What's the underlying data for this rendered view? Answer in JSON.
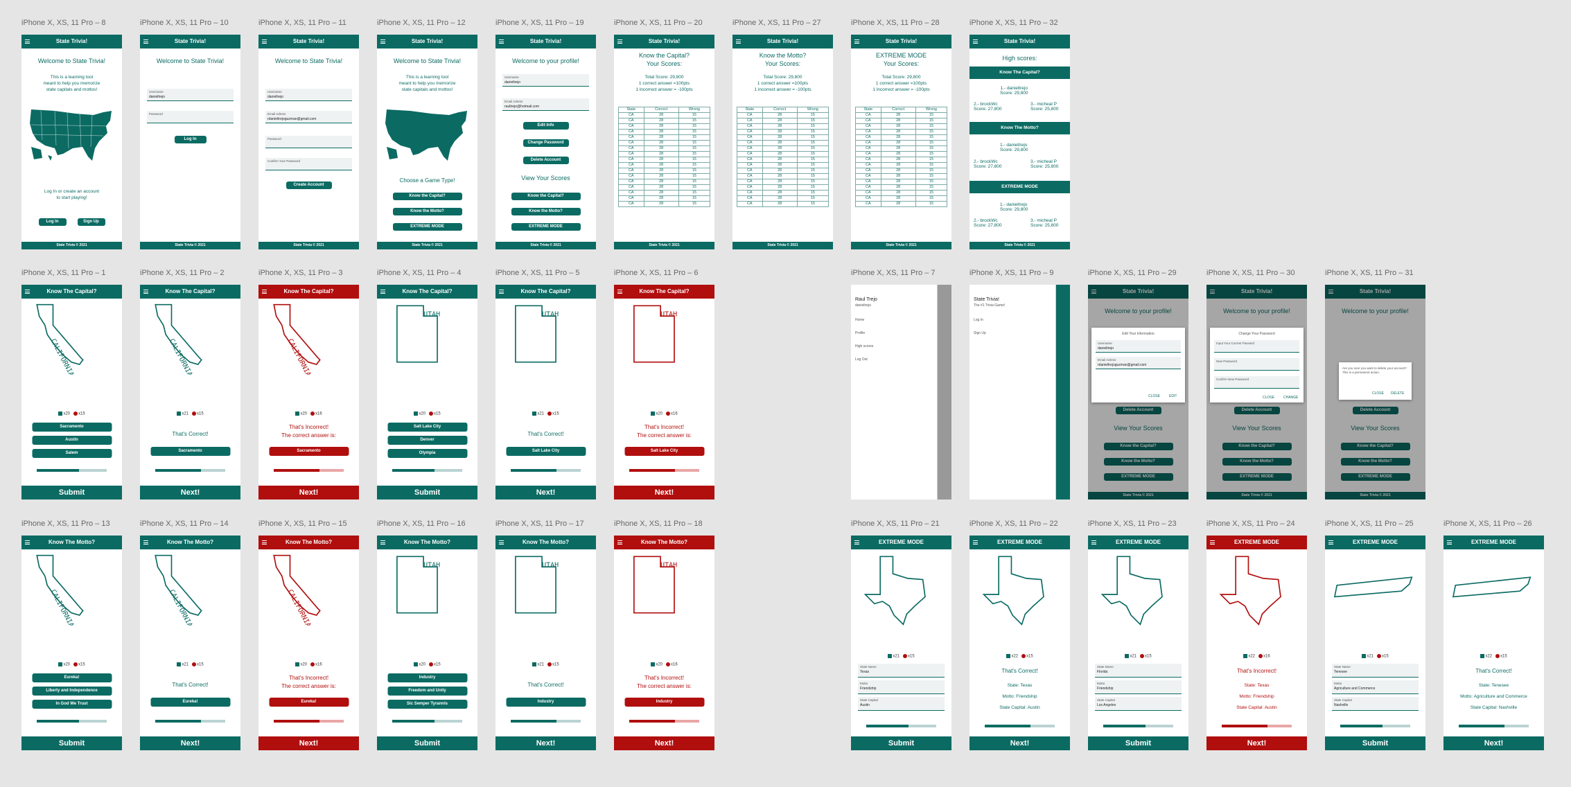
{
  "brand": {
    "accent": "#0b6b63",
    "error": "#b10e0e",
    "canvas_bg": "#e5e5e5"
  },
  "app_title": "State Trivia!",
  "footer_text": "State Trivia © 2021",
  "row1": [
    {
      "label": "iPhone X, XS, 11 Pro – 8"
    },
    {
      "label": "iPhone X, XS, 11 Pro – 10"
    },
    {
      "label": "iPhone X, XS, 11 Pro – 11"
    },
    {
      "label": "iPhone X, XS, 11 Pro – 12"
    },
    {
      "label": "iPhone X, XS, 11 Pro – 19"
    },
    {
      "label": "iPhone X, XS, 11 Pro – 20"
    },
    {
      "label": "iPhone X, XS, 11 Pro – 27"
    },
    {
      "label": "iPhone X, XS, 11 Pro – 28"
    },
    {
      "label": "iPhone X, XS, 11 Pro – 32"
    }
  ],
  "row2": [
    {
      "label": "iPhone X, XS, 11 Pro – 1"
    },
    {
      "label": "iPhone X, XS, 11 Pro – 2"
    },
    {
      "label": "iPhone X, XS, 11 Pro – 3"
    },
    {
      "label": "iPhone X, XS, 11 Pro – 4"
    },
    {
      "label": "iPhone X, XS, 11 Pro – 5"
    },
    {
      "label": "iPhone X, XS, 11 Pro – 6"
    },
    {
      "label": "iPhone X, XS, 11 Pro – 7"
    },
    {
      "label": "iPhone X, XS, 11 Pro – 9"
    },
    {
      "label": "iPhone X, XS, 11 Pro – 29"
    },
    {
      "label": "iPhone X, XS, 11 Pro – 30"
    },
    {
      "label": "iPhone X, XS, 11 Pro – 31"
    }
  ],
  "row3": [
    {
      "label": "iPhone X, XS, 11 Pro – 13"
    },
    {
      "label": "iPhone X, XS, 11 Pro – 14"
    },
    {
      "label": "iPhone X, XS, 11 Pro – 15"
    },
    {
      "label": "iPhone X, XS, 11 Pro – 16"
    },
    {
      "label": "iPhone X, XS, 11 Pro – 17"
    },
    {
      "label": "iPhone X, XS, 11 Pro – 18"
    },
    {
      "label": "iPhone X, XS, 11 Pro – 21"
    },
    {
      "label": "iPhone X, XS, 11 Pro – 22"
    },
    {
      "label": "iPhone X, XS, 11 Pro – 23"
    },
    {
      "label": "iPhone X, XS, 11 Pro – 24"
    },
    {
      "label": "iPhone X, XS, 11 Pro – 25"
    },
    {
      "label": "iPhone X, XS, 11 Pro – 26"
    }
  ],
  "welcome": {
    "title": "Welcome to State Trivia!",
    "blurb_1": "This is a learning tool",
    "blurb_2": "meant to help you memorize",
    "blurb_3": "state capitals and mottos!",
    "cta_1": "Log In or create an account",
    "cta_2": "to start playing!",
    "login": "Log In",
    "signup": "Sign Up"
  },
  "login_form": {
    "username_label": "Username",
    "username_value": "danieltrejo",
    "password_label": "Password",
    "email_label": "Email Adress",
    "email_value": "rdanieltrejoguzman@gmail.com",
    "confirm_label": "Confirm Your Password",
    "login_button": "Log In",
    "create_button": "Create Account"
  },
  "game_select": {
    "prompt": "Choose a Game Type!",
    "capital": "Know the Capital?",
    "motto": "Know the Motto?",
    "extreme": "EXTREME MODE"
  },
  "profile": {
    "title": "Welcome to your profile!",
    "username_label": "Username",
    "username_value": "danieltrejo",
    "email_label": "Email Adress",
    "email_value": "raultrejo@hotmail.com",
    "edit": "Edit Info",
    "change_password": "Change Password",
    "delete": "Delete Account",
    "view_scores": "View Your Scores"
  },
  "scores": {
    "capital_title": "Know the Capital?",
    "motto_title": "Know the Motto?",
    "extreme_title": "EXTREME MODE",
    "subtitle": "Your Scores:",
    "total": "Total Score: 29,800",
    "correct_rule": "1 correct answer =100pts",
    "wrong_rule": "1 incorrect answer = -100pts",
    "headers": [
      "State",
      "Correct",
      "Wrong"
    ],
    "row": [
      "CA",
      "28",
      "15"
    ]
  },
  "highscores": {
    "title": "High scores:",
    "sections": [
      "Know The Capital?",
      "Know The Motto?",
      "EXTREME MODE"
    ],
    "first_name": "1.- danieltrejo",
    "first_score": "Score: 29,800",
    "second_name": "2.- brockWc",
    "second_score": "Score: 27,800",
    "third_name": "3.- micheal P",
    "third_score": "Score: 25,800"
  },
  "quiz": {
    "capital_title": "Know The Capital?",
    "motto_title": "Know The Motto?",
    "extreme_title": "EXTREME MODE",
    "submit": "Submit",
    "next": "Next!",
    "correct": "That's Correct!",
    "incorrect": "That's Incorrect!",
    "correct_answer_is": "The correct answer is:",
    "california": "CALIFORNIA",
    "utah": "UTAH",
    "ca_options": [
      "Sacramento",
      "Austin",
      "Salem"
    ],
    "ut_options": [
      "Salt Lake City",
      "Denver",
      "Olympia"
    ],
    "ca_motto_options": [
      "Eureka!",
      "Liberty and Independence",
      "In God We Trust"
    ],
    "ut_motto_options": [
      "Industry",
      "Freedom and Unity",
      "Sic Semper Tyrannis"
    ],
    "count_20": "x20",
    "count_15": "x15",
    "count_21": "x21",
    "count_16": "x16",
    "count_22": "x22"
  },
  "extreme": {
    "state_name_label": "State Name",
    "motto_label": "Motto",
    "capital_label": "State Capital",
    "texas": "Texas",
    "friendship": "Friendship",
    "austin": "Austin",
    "florida": "Florida",
    "los_angeles": "Los Angeles",
    "tenesee": "Tenesee",
    "agri": "Agriculture and Commerce",
    "nashville": "Nashville",
    "result_state_tx": "State: Texas",
    "result_motto_tx": "Motto: Friendship",
    "result_cap_tx": "State Capital: Austin",
    "result_state_tn": "State: Tenesee",
    "result_motto_tn": "Motto: Agriculture and Commerce",
    "result_cap_tn": "State Capital: Nashville"
  },
  "drawer": {
    "name": "Raul Trejo",
    "handle": "danieltrejo",
    "items": [
      "Home",
      "Profile",
      "High scores",
      "Log Out"
    ],
    "guest_title": "State Trivia!",
    "guest_sub": "The #1 Trivia Game!",
    "guest_items": [
      "Log In",
      "Sign Up"
    ]
  },
  "dialogs": {
    "edit_title": "Edit Your Information",
    "close": "CLOSE",
    "edit": "EDIT",
    "change_title": "Change Your Password",
    "current_pw": "Input Your Current Passwrd",
    "new_pw": "New Password",
    "confirm_pw": "Confirm New Password",
    "change": "CHANGE",
    "delete_msg": "Are you sure you want to delete your account? This is a permanent action.",
    "delete": "DELETE"
  }
}
